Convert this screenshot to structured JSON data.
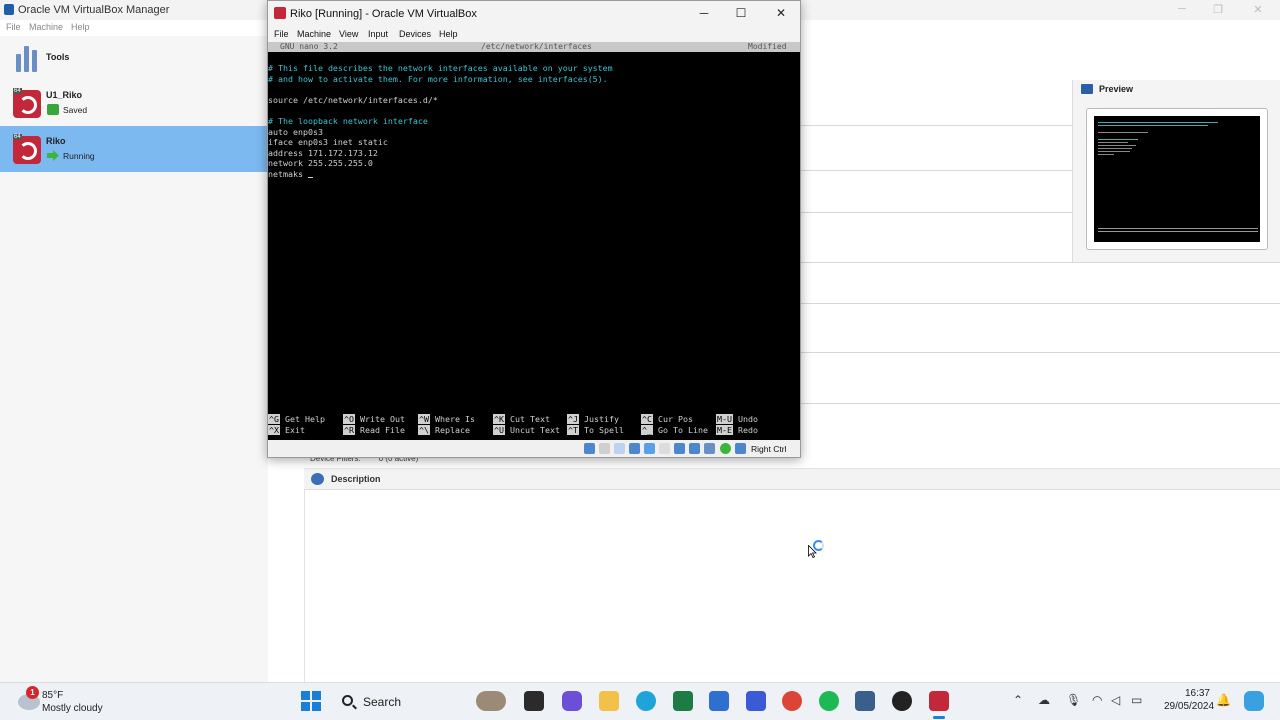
{
  "manager": {
    "title": "Oracle VM VirtualBox Manager",
    "menu": [
      "File",
      "Machine",
      "Help"
    ],
    "tools_label": "Tools",
    "vms": [
      {
        "name": "U1_Riko",
        "state": "Saved",
        "badge": "64"
      },
      {
        "name": "Riko",
        "state": "Running",
        "badge": "64"
      }
    ],
    "preview_label": "Preview",
    "device_filters_label": "Device Filters:",
    "device_filters_value": "0 (0 active)",
    "description_label": "Description"
  },
  "vm_window": {
    "title": "Riko [Running] - Oracle VM VirtualBox",
    "menu": [
      "File",
      "Machine",
      "View",
      "Input",
      "Devices",
      "Help"
    ],
    "host_key": "Right Ctrl"
  },
  "nano": {
    "version": "GNU nano 3.2",
    "file": "/etc/network/interfaces",
    "status": "Modified",
    "lines": [
      {
        "text": "# This file describes the network interfaces available on your system",
        "comment": true
      },
      {
        "text": "# and how to activate them. For more information, see interfaces(5).",
        "comment": true
      },
      {
        "text": "",
        "comment": false
      },
      {
        "text": "source /etc/network/interfaces.d/*",
        "comment": false
      },
      {
        "text": "",
        "comment": false
      },
      {
        "text": "# The loopback network interface",
        "comment": true
      },
      {
        "text": "auto enp0s3",
        "comment": false
      },
      {
        "text": "iface enp0s3 inet static",
        "comment": false
      },
      {
        "text": "address 171.172.173.12",
        "comment": false
      },
      {
        "text": "network 255.255.255.0",
        "comment": false
      },
      {
        "text": "netmaks ",
        "comment": false
      }
    ],
    "shortcuts": [
      {
        "k1": "^G",
        "l1": "Get Help",
        "k2": "^X",
        "l2": "Exit"
      },
      {
        "k1": "^O",
        "l1": "Write Out",
        "k2": "^R",
        "l2": "Read File"
      },
      {
        "k1": "^W",
        "l1": "Where Is",
        "k2": "^\\",
        "l2": "Replace"
      },
      {
        "k1": "^K",
        "l1": "Cut Text",
        "k2": "^U",
        "l2": "Uncut Text"
      },
      {
        "k1": "^J",
        "l1": "Justify",
        "k2": "^T",
        "l2": "To Spell"
      },
      {
        "k1": "^C",
        "l1": "Cur Pos",
        "k2": "^_",
        "l2": "Go To Line"
      },
      {
        "k1": "M-U",
        "l1": "Undo",
        "k2": "M-E",
        "l2": "Redo"
      }
    ]
  },
  "taskbar": {
    "weather_temp": "85°F",
    "weather_cond": "Mostly cloudy",
    "weather_alert": "1",
    "search_label": "Search",
    "time": "16:37",
    "date": "29/05/2024"
  },
  "colors": {
    "selection": "#7cb9f0",
    "terminal_bg": "#000000",
    "terminal_comment": "#3fc2cf",
    "accent": "#1a7fd8"
  }
}
